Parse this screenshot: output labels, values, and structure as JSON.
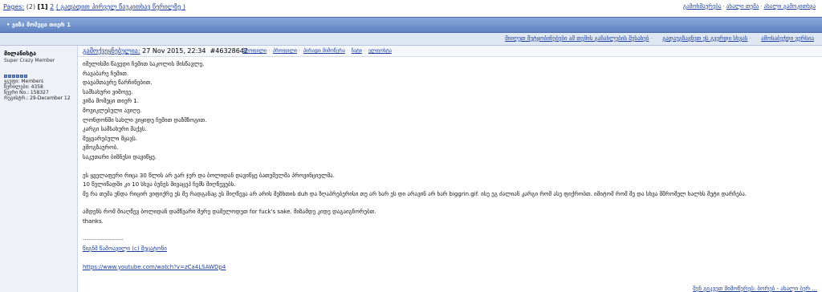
{
  "pagination": {
    "label": "Pages:",
    "total": "(2)",
    "current": "[1]",
    "next": "2",
    "jump_label": "( გადადით პირველ წაუკითხავ წერილზე )"
  },
  "top_actions": [
    "გამოხმაურება",
    "ახალი თემა",
    "ახალი გამოკითხვა"
  ],
  "topic": {
    "title": "• ვიზა მომეცი თიერ 1"
  },
  "topic_options": [
    "მიიღეთ შეტყობინებები ამ თემის განახლების შესახებ",
    "გადაუგზავნეთ ეს გვერდი სხვას",
    "ამოსაბეჭდი ვერსია"
  ],
  "post": {
    "author": {
      "name": "მილანისტა",
      "rank": "Super Crazy Member",
      "pips": 6,
      "info": [
        "ჯგუფი: Members",
        "წერილები: 4358",
        "წევრი No.: 158327",
        "რეგისტრ.: 29-December 12"
      ]
    },
    "timestamp_label": "გამოქვეყნებულია:",
    "timestamp": "27 Nov 2015, 22:34",
    "post_id": "#46328642",
    "actions": [
      "პროფილი",
      "პროფილი",
      "პირადი მიმოწერა",
      "ჩატი",
      "ელფოსტა"
    ],
    "lines": [
      "იმელისში წავედი ჩემით საკოლის მისწავლე.",
      "რავაბარე ჩემით.",
      "დავამთავრე წარჩინებით.",
      "სამსახური ვიშოვე.",
      "ვიზა მომეცი თიერ 1.",
      "მოვიკლებული ავიღე.",
      "ლონდონში სახლი ვიყიდე ჩემით დაზმზოგით.",
      "კარგი სამსახური მაქვს.",
      "შეყვარებული მყავს.",
      "ვმოგზაურობ.",
      "საკუთარი ბიზნესი დავიწყე.",
      "",
      "ეს ყველაფერი რიცა 30 წლის არ ვარ ჯერ და ბოლიდან დავიწყე ბათუმელმა პროვინციელმა.",
      "10 წელიწადში კი 10 სხვა ბუნეს მივაცეპ ჩემს მიღწევებს.",
      "მე რა თემა უნდა რიცირ ვიფიქრე ეს მე რადგანაც ეს მიღწევა არ არის მეზხთის duh და ზღაპრებერისი თუ არ ხარ ეს დი არავინ არ ხარ biggrin.gif. ისე ეგ ძალიან კარგი რომ ასე ფიქრობთ. იმიტომ რომ მე და სხვა მშრომელ ხალხს მეტი დარჩება.",
      "",
      "ამდენს რომ მიაღწევ ბოლიდან დამწვარი მერე დამელოდეთ for fuck's sake. მიზამდე კიდე დაგაიგნორებთ.",
      "thanks."
    ],
    "signature": {
      "separator": "--------------------",
      "copyright": "წიგნმ წამოავილი (c) შეცატონი",
      "link": "https://www.youtube.com/watch?v=zCa4LSAWDp4"
    }
  },
  "footer": "შენ გიკვეთ მიმოწერებ: ბორებ - ახალი ბერ ...",
  "colors": {
    "link": "#1a3ca0",
    "titlebar": "#6f8fd0",
    "sidebar": "#eef2f8"
  }
}
